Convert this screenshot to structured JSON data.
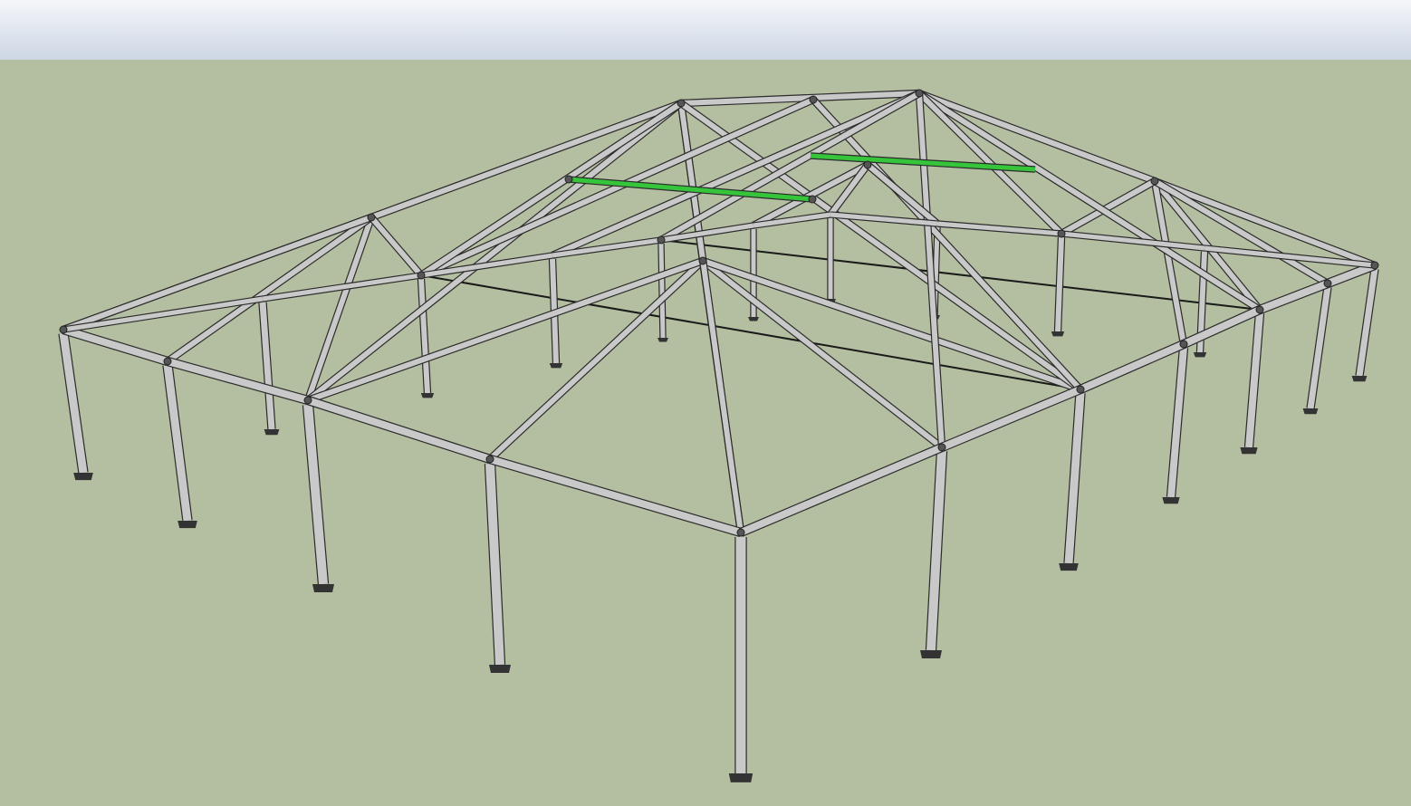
{
  "scene": {
    "sky_color_top": "#f4f6f9",
    "sky_color_bottom": "#cdd6e4",
    "ground_color": "#b3bfa0",
    "frame_color": "#c9c9c9",
    "frame_outline_color": "#2b2b2b",
    "purlin_highlight_color": "#35c43a",
    "base_plate_color": "#333333"
  }
}
